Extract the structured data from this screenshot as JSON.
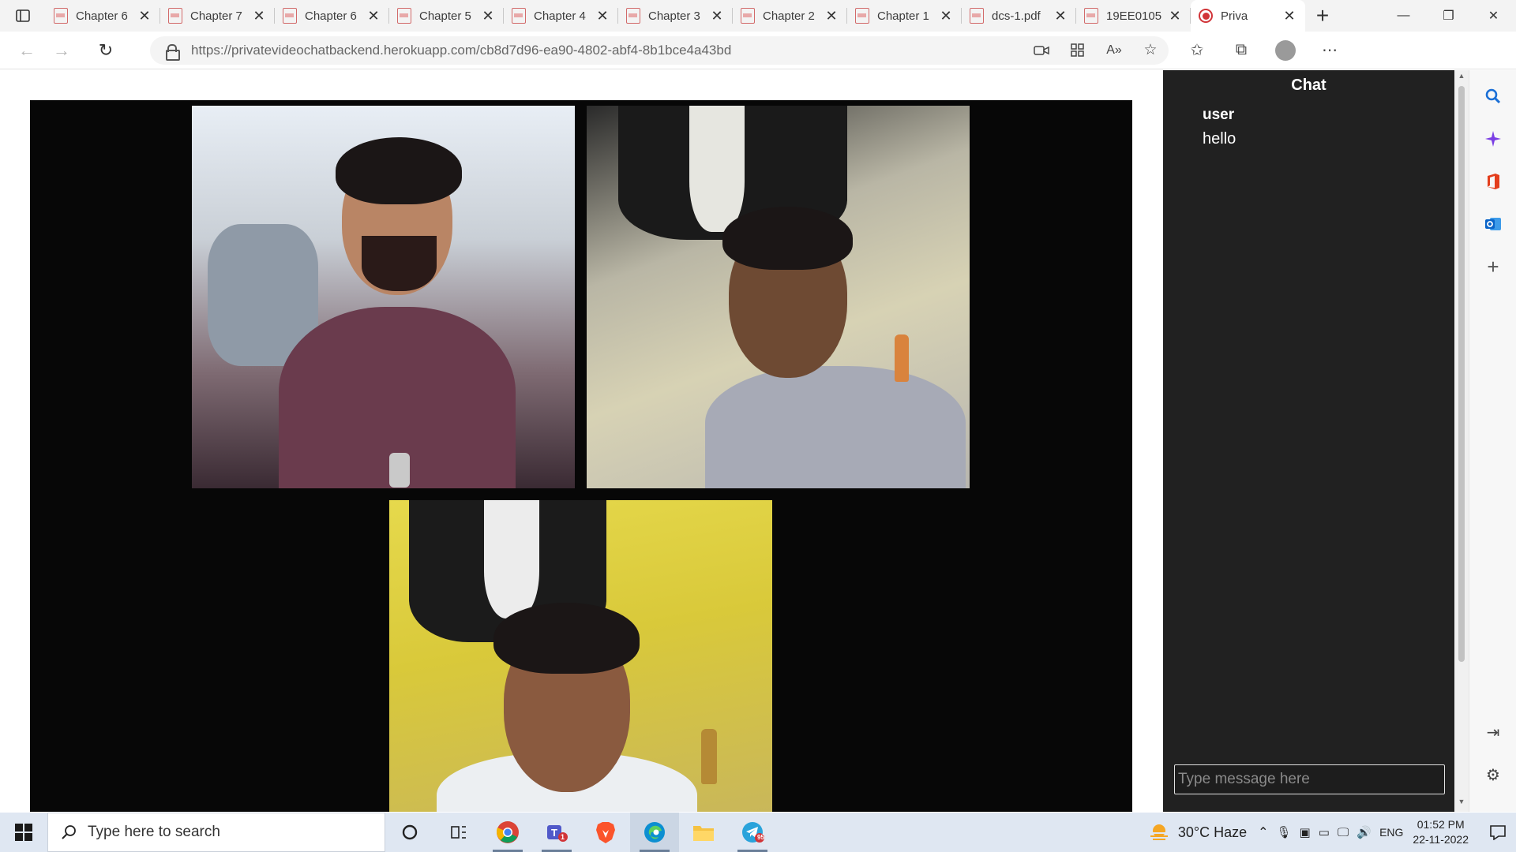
{
  "browser": {
    "tabs": [
      {
        "title": "Chapter 6",
        "type": "pdf"
      },
      {
        "title": "Chapter 7",
        "type": "pdf"
      },
      {
        "title": "Chapter 6",
        "type": "pdf"
      },
      {
        "title": "Chapter 5",
        "type": "pdf"
      },
      {
        "title": "Chapter 4",
        "type": "pdf"
      },
      {
        "title": "Chapter 3",
        "type": "pdf"
      },
      {
        "title": "Chapter 2",
        "type": "pdf"
      },
      {
        "title": "Chapter 1",
        "type": "pdf"
      },
      {
        "title": "dcs-1.pdf",
        "type": "pdf"
      },
      {
        "title": "19EE0105",
        "type": "pdf"
      },
      {
        "title": "Priva",
        "type": "page",
        "active": true,
        "recording": true
      }
    ],
    "address": {
      "domain": "https://privatevideochatbackend.herokuapp.com",
      "path": "/cb8d7d96-ea90-4802-abf4-8b1bce4a43bd"
    }
  },
  "videos": [
    {
      "participant": "participant-1"
    },
    {
      "participant": "participant-2"
    },
    {
      "participant": "participant-3"
    }
  ],
  "chat": {
    "title": "Chat",
    "messages": [
      {
        "user": "user",
        "text": "hello"
      }
    ],
    "input_placeholder": "Type message here"
  },
  "taskbar": {
    "search_placeholder": "Type here to search",
    "weather": "30°C  Haze",
    "language": "ENG",
    "time": "01:52 PM",
    "date": "22-11-2022",
    "teams_badge": "1",
    "telegram_badge": "95"
  },
  "colors": {
    "chat_bg": "#212121",
    "stage_bg": "#070707",
    "taskbar_bg": "#dfe7f2",
    "recording_red": "#d13438"
  }
}
